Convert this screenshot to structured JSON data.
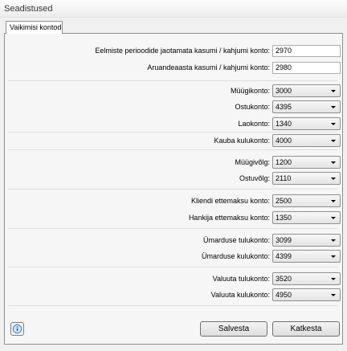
{
  "window": {
    "title": "Seadistused"
  },
  "tabs": [
    {
      "label": "Vaikimisi kontod"
    }
  ],
  "fields": {
    "unallocated_profit": {
      "label": "Eelmiste perioodide jaotamata kasumi / kahjumi konto:",
      "value": "2970"
    },
    "year_profit": {
      "label": "Aruandeaasta kasumi / kahjumi konto:",
      "value": "2980"
    },
    "sales": {
      "label": "Müügikonto:",
      "value": "3000"
    },
    "purchase": {
      "label": "Ostukonto:",
      "value": "4395"
    },
    "stock": {
      "label": "Laokonto:",
      "value": "1340"
    },
    "goods_expense": {
      "label": "Kauba kulukonto:",
      "value": "4000"
    },
    "receivable": {
      "label": "Müügivõlg:",
      "value": "1200"
    },
    "payable": {
      "label": "Ostuvõlg:",
      "value": "2110"
    },
    "customer_prepay": {
      "label": "Kliendi ettemaksu konto:",
      "value": "2500"
    },
    "supplier_prepay": {
      "label": "Hankija ettemaksu konto:",
      "value": "1350"
    },
    "rounding_income": {
      "label": "Ümarduse tulukonto:",
      "value": "3099"
    },
    "rounding_expense": {
      "label": "Ümarduse kulukonto:",
      "value": "4399"
    },
    "currency_income": {
      "label": "Valuuta tulukonto:",
      "value": "3520"
    },
    "currency_expense": {
      "label": "Valuuta kulukonto:",
      "value": "4950"
    }
  },
  "buttons": {
    "save": "Salvesta",
    "cancel": "Katkesta"
  },
  "icons": {
    "help": "help-icon",
    "dropdown": "chevron-down-icon"
  }
}
